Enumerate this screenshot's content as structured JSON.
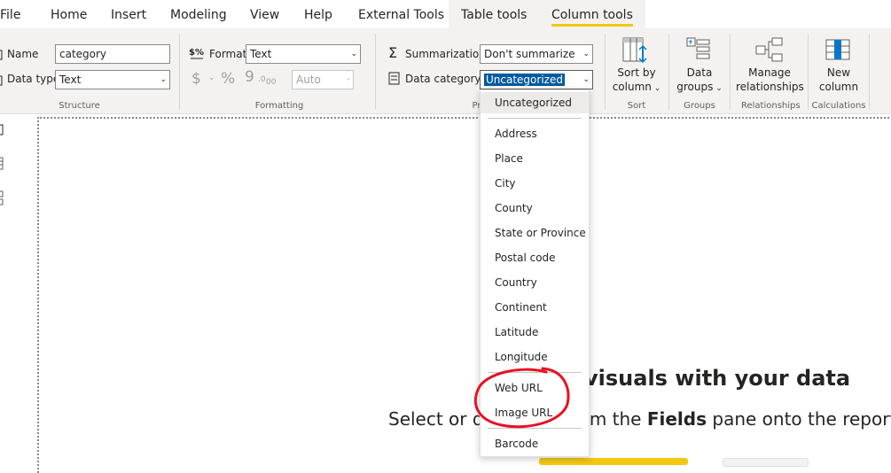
{
  "tabs": [
    {
      "label": "File"
    },
    {
      "label": "Home"
    },
    {
      "label": "Insert"
    },
    {
      "label": "Modeling"
    },
    {
      "label": "View"
    },
    {
      "label": "Help"
    },
    {
      "label": "External Tools"
    },
    {
      "label": "Table tools"
    },
    {
      "label": "Column tools"
    }
  ],
  "structure": {
    "name_label": "Name",
    "name_value": "category",
    "datatype_label": "Data type",
    "datatype_value": "Text",
    "caption": "Structure"
  },
  "formatting": {
    "format_label": "Format",
    "format_value": "Text",
    "currency_symbol": "$",
    "percent_symbol": "%",
    "comma_symbol": "9",
    "decimal_value": "Auto",
    "caption": "Formatting"
  },
  "properties": {
    "summarization_label": "Summarization",
    "summarization_value": "Don't summarize",
    "datacategory_label": "Data category",
    "datacategory_value": "Uncategorized",
    "caption": "Pr"
  },
  "sort": {
    "label_line1": "Sort by",
    "label_line2": "column",
    "caption": "Sort"
  },
  "groups": {
    "label_line1": "Data",
    "label_line2": "groups",
    "caption": "Groups"
  },
  "relationships": {
    "label_line1": "Manage",
    "label_line2": "relationships",
    "caption": "Relationships"
  },
  "calculations": {
    "label_line1": "New",
    "label_line2": "column",
    "caption": "Calculations"
  },
  "dropdown": {
    "selected": "Uncategorized",
    "items": [
      "Address",
      "Place",
      "City",
      "County",
      "State or Province",
      "Postal code",
      "Country",
      "Continent",
      "Latitude",
      "Longitude"
    ],
    "url_items": [
      "Web URL",
      "Image URL"
    ],
    "last_item": "Barcode"
  },
  "canvas": {
    "headline": "visuals with your data",
    "sub_part1": "Select or d",
    "sub_part2": "om the ",
    "sub_bold": "Fields",
    "sub_part3": " pane onto the report"
  },
  "colors": {
    "accent": "#f2c811",
    "highlight": "#005a9e",
    "annotation": "#e81123"
  }
}
